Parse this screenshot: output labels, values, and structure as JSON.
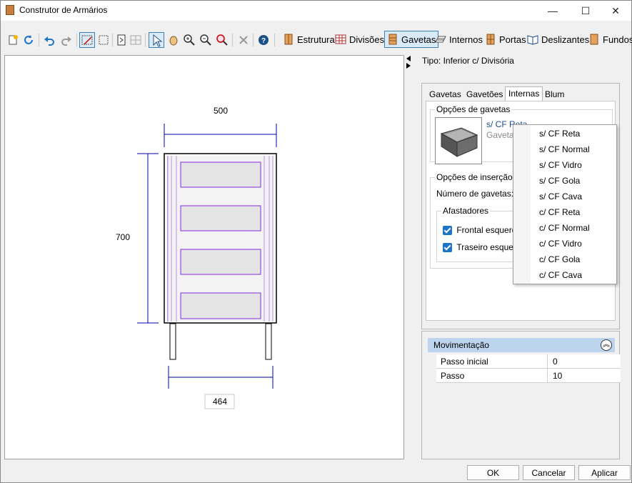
{
  "window": {
    "title": "Construtor de Armários",
    "minimize_glyph": "—",
    "maximize_glyph": "☐",
    "close_glyph": "✕"
  },
  "toolbar": {
    "tabs": [
      {
        "label": "Estrutura",
        "icon": "cabinet-structure-icon"
      },
      {
        "label": "Divisões",
        "icon": "grid-divisions-icon"
      },
      {
        "label": "Gavetas",
        "icon": "drawer-icon"
      },
      {
        "label": "Internos",
        "icon": "shelf-internal-icon"
      },
      {
        "label": "Portas",
        "icon": "door-icon"
      },
      {
        "label": "Deslizantes",
        "icon": "sliding-book-icon"
      },
      {
        "label": "Fundos",
        "icon": "back-panel-icon"
      }
    ],
    "active_tab": "Gavetas"
  },
  "canvas": {
    "dim_width": "500",
    "dim_height": "700",
    "dim_inner_width": "464"
  },
  "panel": {
    "type_label": "Tipo: Inferior c/ Divisória",
    "tabs": [
      "Gavetas",
      "Gavetões",
      "Internas",
      "Blum"
    ],
    "active_tab": "Internas",
    "drawer_options_title": "Opções de gavetas",
    "selected_type": "s/ CF Reta",
    "selected_desc": "Gaveta",
    "insert_options_title": "Opções de inserção",
    "num_drawers_label": "Número de gavetas:",
    "spacers_title": "Afastadores",
    "front_left_label": "Frontal esquerdo",
    "back_left_label": "Traseiro esquerdo",
    "front_left_checked": true,
    "back_left_checked": true
  },
  "dropdown": {
    "items": [
      "s/ CF Reta",
      "s/ CF Normal",
      "s/ CF Vidro",
      "s/ CF Gola",
      "s/ CF Cava",
      "c/ CF Reta",
      "c/ CF Normal",
      "c/ CF Vidro",
      "c/ CF Gola",
      "c/ CF Cava"
    ]
  },
  "movement": {
    "title": "Movimentação",
    "rows": [
      {
        "name": "Passo inicial",
        "value": "0"
      },
      {
        "name": "Passo",
        "value": "10"
      }
    ]
  },
  "buttons": {
    "ok": "OK",
    "cancel": "Cancelar",
    "apply": "Aplicar"
  },
  "colors": {
    "accent": "#1d73c6",
    "dimension_line": "#0000b0",
    "cabinet_outline": "#8a2be2",
    "header_blue": "#bcd4ee"
  }
}
